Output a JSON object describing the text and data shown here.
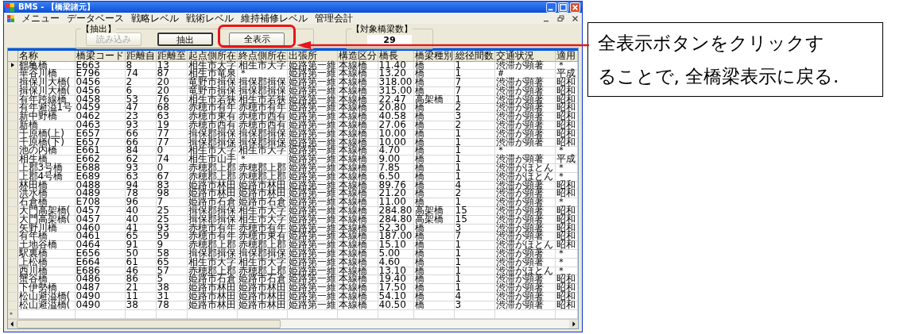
{
  "window": {
    "title": "BMS - 【橋梁諸元】"
  },
  "menu": [
    "メニュー",
    "データベース",
    "戦略レベル",
    "戦術レベル",
    "維持補修レベル",
    "管理会計"
  ],
  "extract_group": {
    "title": "【抽出】",
    "buttons": [
      {
        "label": "読み込み",
        "disabled": true,
        "focused": false,
        "highlighted": false
      },
      {
        "label": "抽出",
        "disabled": false,
        "focused": true,
        "highlighted": false
      },
      {
        "label": "全表示",
        "disabled": false,
        "focused": false,
        "highlighted": true
      }
    ]
  },
  "count_group": {
    "title": "【対象橋梁数】",
    "value": "29"
  },
  "table": {
    "columns": [
      "名称",
      "橋梁コード",
      "距離自",
      "距離至",
      "起点側所在",
      "終点側所在",
      "出張所",
      "構造区分",
      "橋長",
      "橋梁種別",
      "総径間数",
      "交通状況",
      "適用"
    ],
    "rows": [
      {
        "selected": true,
        "cells": [
          "鶴亀橋",
          "E663",
          "8",
          "13",
          "相生市大字",
          "相生市大字",
          "姫路第一維",
          "本線橋",
          "11.40",
          "橋",
          "1",
          "渋滞が顕著",
          "＊"
        ]
      },
      {
        "selected": false,
        "cells": [
          "華谷川橋",
          "E796",
          "74",
          "87",
          "相生市竜泉",
          "＊",
          "姫路第一維",
          "本線橋",
          "13.20",
          "橋",
          "1",
          "＃",
          "平成"
        ]
      },
      {
        "selected": false,
        "cells": [
          "揖保川大橋(",
          "0456",
          "2",
          "20",
          "竜野市揖保",
          "揖保郡揖保",
          "姫路第一維",
          "本線橋",
          "318.00",
          "橋",
          "7",
          "渋滞が顕著",
          "昭和"
        ]
      },
      {
        "selected": false,
        "cells": [
          "揖保川大橋(",
          "0456",
          "6",
          "20",
          "竜野市揖保",
          "揖保郡揖保",
          "姫路第一維",
          "本線橋",
          "315.00",
          "橋",
          "7",
          "渋滞が顕著",
          "昭和"
        ]
      },
      {
        "selected": false,
        "cells": [
          "有年跨線橋",
          "0458",
          "53",
          "76",
          "相生市若狭",
          "相生市若狭",
          "姫路第一維",
          "本線橋",
          "22.47",
          "高架橋",
          "1",
          "渋滞が顕著",
          "昭和"
        ]
      },
      {
        "selected": false,
        "cells": [
          "有年避溢1号",
          "0459",
          "47",
          "68",
          "赤穂市有年",
          "赤穂市有年",
          "姫路第一維",
          "本線橋",
          "20.80",
          "橋",
          "2",
          "渋滞が顕著",
          "昭和"
        ]
      },
      {
        "selected": false,
        "cells": [
          "新中野橋",
          "0462",
          "23",
          "63",
          "赤穂市東有",
          "赤穂市西有",
          "姫路第一維",
          "本線橋",
          "40.58",
          "橋",
          "3",
          "渋滞が顕著",
          "昭和"
        ]
      },
      {
        "selected": false,
        "cells": [
          "新橋",
          "0463",
          "93",
          "19",
          "赤穂市西有",
          "赤穂市西有",
          "姫路第一維",
          "本線橋",
          "27.06",
          "橋",
          "2",
          "渋滞が顕著",
          "昭和"
        ]
      },
      {
        "selected": false,
        "cells": [
          "千原橋(上)",
          "E657",
          "66",
          "77",
          "揖保郡揖保",
          "揖保郡揖保",
          "姫路第一維",
          "本線橋",
          "10.00",
          "橋",
          "1",
          "渋滞が顕著",
          "昭和"
        ]
      },
      {
        "selected": false,
        "cells": [
          "千原橋(下)",
          "E657",
          "66",
          "77",
          "揖保郡揖保",
          "揖保郡揖保",
          "姫路第一維",
          "本線橋",
          "10.00",
          "橋",
          "1",
          "渋滞が顕著",
          "昭和"
        ]
      },
      {
        "selected": false,
        "cells": [
          "池の内橋",
          "E661",
          "84",
          "0",
          "相生市大字",
          "相生市大字",
          "姫路第一維",
          "本線橋",
          "4.70",
          "橋",
          "1",
          "＊",
          "＊"
        ]
      },
      {
        "selected": false,
        "cells": [
          "相生橋",
          "E662",
          "62",
          "74",
          "相生市山手",
          "＊",
          "姫路第一維",
          "本線橋",
          "9.00",
          "橋",
          "1",
          "渋滞が顕著",
          "平成"
        ]
      },
      {
        "selected": false,
        "cells": [
          "上郡3号橋",
          "E688",
          "93",
          "0",
          "赤穂郡上郡",
          "赤穂郡上郡",
          "姫路第一維",
          "本線橋",
          "7.85",
          "橋",
          "1",
          "渋滞がほとん",
          "＊"
        ]
      },
      {
        "selected": false,
        "cells": [
          "上郡4号橋",
          "E689",
          "63",
          "67",
          "赤穂郡上郡",
          "赤穂郡上郡",
          "姫路第一維",
          "本線橋",
          "6.50",
          "橋",
          "1",
          "渋滞がほとん",
          "＊"
        ]
      },
      {
        "selected": false,
        "cells": [
          "林田橋",
          "0488",
          "94",
          "83",
          "姫路市林田",
          "姫路市林田",
          "姫路第一維",
          "本線橋",
          "89.76",
          "橋",
          "4",
          "渋滞が顕著",
          "昭和"
        ]
      },
      {
        "selected": false,
        "cells": [
          "洪水橋",
          "0489",
          "78",
          "98",
          "姫路市林田",
          "姫路市林田",
          "姫路第一維",
          "本線橋",
          "21.20",
          "橋",
          "2",
          "渋滞が顕著",
          "昭和"
        ]
      },
      {
        "selected": false,
        "cells": [
          "石倉橋",
          "E708",
          "96",
          "7",
          "姫路市石倉",
          "姫路市石倉",
          "姫路第一維",
          "本線橋",
          "11.00",
          "橋",
          "1",
          "渋滞が顕著",
          "＊"
        ]
      },
      {
        "selected": false,
        "cells": [
          "大門高架橋(",
          "0457",
          "40",
          "25",
          "揖保郡揖保",
          "相生市大字",
          "姫路第一維",
          "本線橋",
          "284.80",
          "高架橋",
          "15",
          "渋滞が顕著",
          "昭和"
        ]
      },
      {
        "selected": false,
        "cells": [
          "大門高架橋(",
          "0457",
          "40",
          "25",
          "揖保郡揖保",
          "相生市大字",
          "姫路第一維",
          "本線橋",
          "284.80",
          "高架橋",
          "15",
          "渋滞が顕著",
          "昭和"
        ]
      },
      {
        "selected": false,
        "cells": [
          "矢野川橋",
          "0460",
          "41",
          "93",
          "赤穂市有年",
          "赤穂市有年",
          "姫路第一維",
          "本線橋",
          "52.30",
          "橋",
          "3",
          "渋滞が顕著",
          "昭和"
        ]
      },
      {
        "selected": false,
        "cells": [
          "有年橋",
          "0461",
          "65",
          "59",
          "赤穂市有年",
          "赤穂市東有",
          "姫路第一維",
          "本線橋",
          "187.00",
          "橋",
          "7",
          "渋滞が顕著",
          "昭和"
        ]
      },
      {
        "selected": false,
        "cells": [
          "土地谷橋",
          "0464",
          "91",
          "9",
          "赤穂郡上郡",
          "赤穂郡上郡",
          "姫路第一維",
          "本線橋",
          "15.10",
          "橋",
          "1",
          "渋滞がほとん",
          "昭和"
        ]
      },
      {
        "selected": false,
        "cells": [
          "駅裏橋",
          "E656",
          "50",
          "58",
          "揖保郡揖保",
          "揖保郡揖保",
          "姫路第一維",
          "本線橋",
          "5.00",
          "橋",
          "1",
          "渋滞が顕著",
          "＊"
        ]
      },
      {
        "selected": false,
        "cells": [
          "上松橋",
          "E664",
          "61",
          "65",
          "相生市大字",
          "相生市大字",
          "姫路第一維",
          "本線橋",
          "4.60",
          "橋",
          "1",
          "渋滞が顕著",
          "＊"
        ]
      },
      {
        "selected": false,
        "cells": [
          "西川橋",
          "E686",
          "46",
          "57",
          "赤穂郡上郡",
          "赤穂郡上郡",
          "姫路第一維",
          "本線橋",
          "13.10",
          "橋",
          "1",
          "渋滞がほとん",
          "＊"
        ]
      },
      {
        "selected": false,
        "cells": [
          "蟹谷橋",
          "0486",
          "86",
          "5",
          "姫路市石倉",
          "姫路市石倉",
          "姫路第一維",
          "本線橋",
          "19.40",
          "橋",
          "1",
          "渋滞が顕著",
          "昭和"
        ]
      },
      {
        "selected": false,
        "cells": [
          "下伊勢橋",
          "0487",
          "21",
          "38",
          "姫路市林田",
          "姫路市林田",
          "姫路第一維",
          "本線橋",
          "17.50",
          "橋",
          "1",
          "渋滞が顕著",
          "昭和"
        ]
      },
      {
        "selected": false,
        "cells": [
          "松山避溢橋(",
          "0490",
          "11",
          "31",
          "姫路市林田",
          "姫路市林田",
          "姫路第一維",
          "本線橋",
          "54.10",
          "橋",
          "4",
          "渋滞が顕著",
          "昭和"
        ]
      },
      {
        "selected": false,
        "cells": [
          "松山避溢橋(",
          "0490",
          "38",
          "78",
          "姫路市林田",
          "姫路市林田",
          "姫路第一維",
          "本線橋",
          "40.50",
          "橋",
          "3",
          "渋滞が顕著",
          "昭和"
        ]
      }
    ],
    "new_row_marker": "＊"
  },
  "callout": {
    "text": "全表示ボタンをクリックすることで, 全橋梁表示に戻る."
  }
}
